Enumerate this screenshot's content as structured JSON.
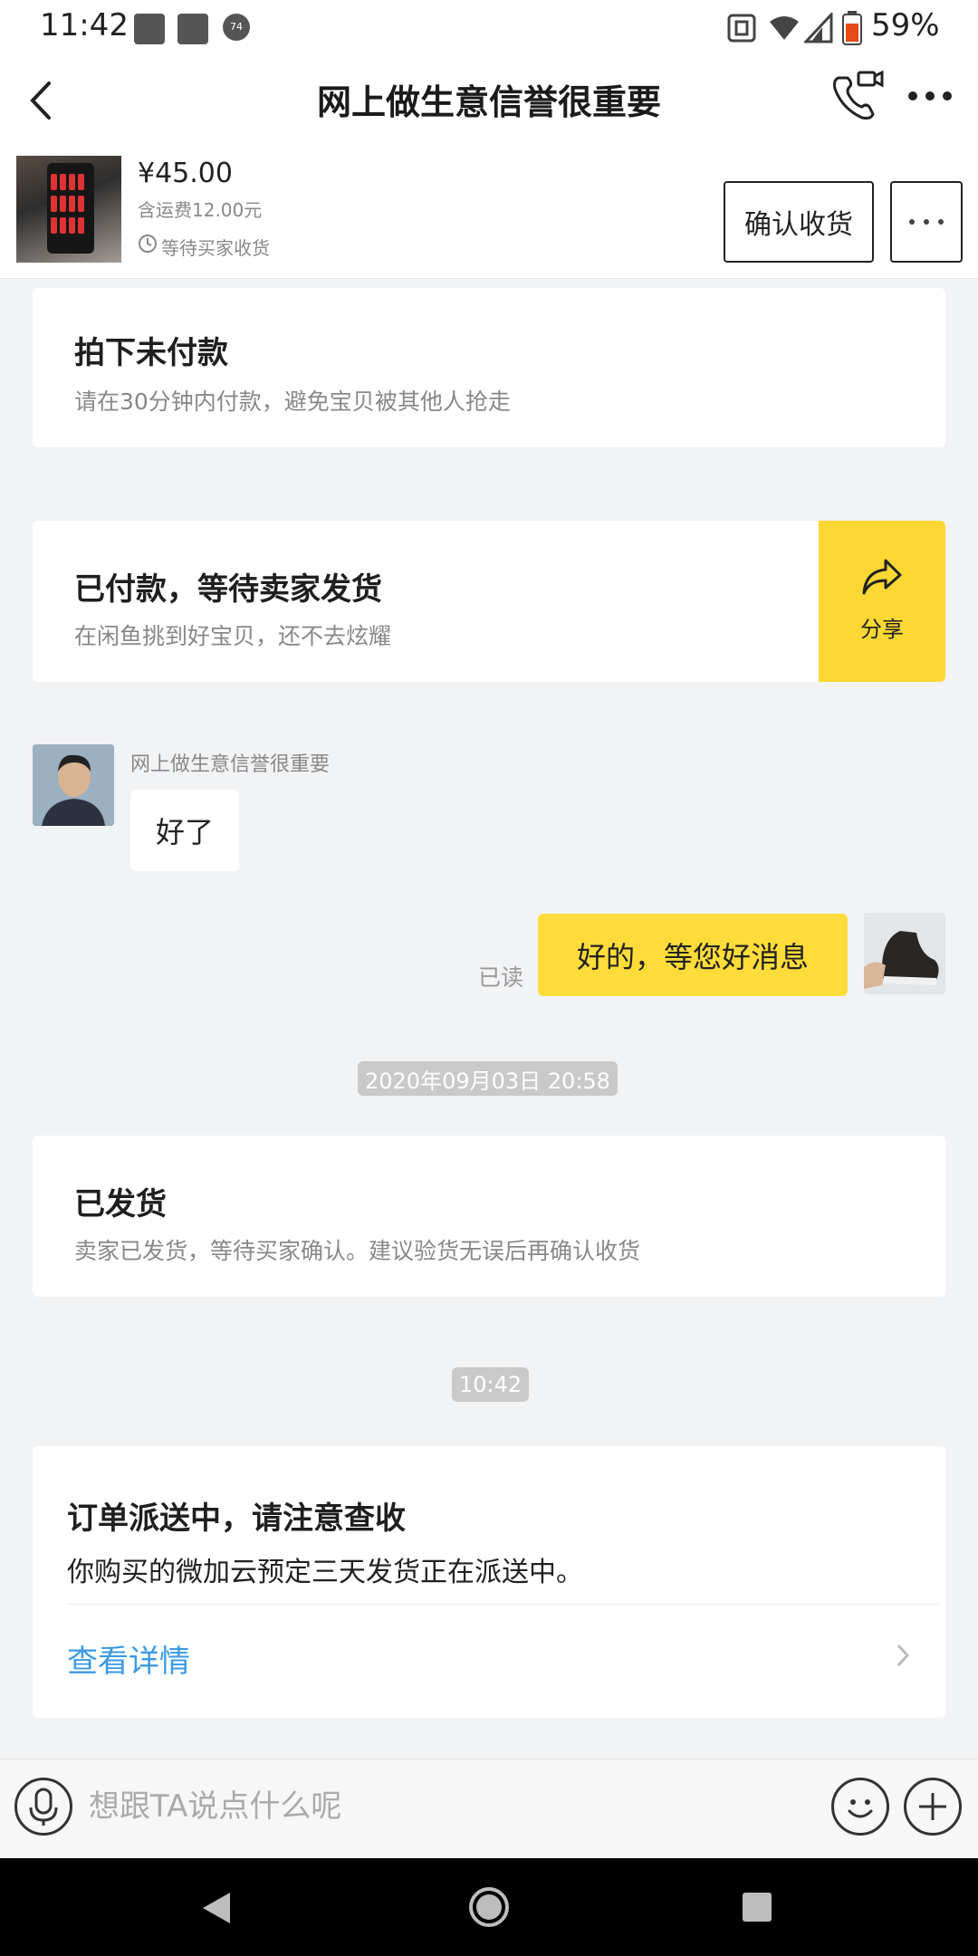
{
  "status_bar": {
    "time": "11:42",
    "notif_badge": "74",
    "battery": "59%"
  },
  "header": {
    "title": "网上做生意信誉很重要"
  },
  "order": {
    "price": "¥45.00",
    "shipping": "含运费12.00元",
    "status": "等待买家收货",
    "confirm_label": "确认收货"
  },
  "messages": {
    "unpaid": {
      "title": "拍下未付款",
      "subtitle": "请在30分钟内付款，避免宝贝被其他人抢走"
    },
    "paid": {
      "title": "已付款，等待卖家发货",
      "subtitle": "在闲鱼挑到好宝贝，还不去炫耀",
      "share_label": "分享"
    },
    "incoming": {
      "sender": "网上做生意信誉很重要",
      "text": "好了"
    },
    "outgoing": {
      "text": "好的，等您好消息",
      "read_status": "已读"
    },
    "timestamp_1": "2020年09月03日 20:58",
    "shipped": {
      "title": "已发货",
      "subtitle": "卖家已发货，等待买家确认。建议验货无误后再确认收货"
    },
    "timestamp_2": "10:42",
    "delivery": {
      "title": "订单派送中，请注意查收",
      "subtitle": "你购买的微加云预定三天发货正在派送中。",
      "link": "查看详情"
    }
  },
  "input": {
    "placeholder": "想跟TA说点什么呢"
  },
  "colors": {
    "accent_yellow": "#fdd835",
    "link_blue": "#3a9ae6",
    "background": "#f2f3f5"
  }
}
